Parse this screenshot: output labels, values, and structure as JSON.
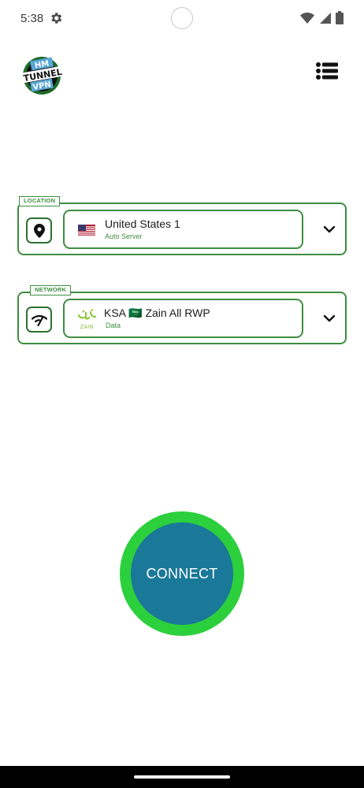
{
  "status_bar": {
    "time": "5:38",
    "icons": [
      "settings-gear-icon",
      "wifi-icon",
      "signal-icon",
      "battery-icon"
    ]
  },
  "header": {
    "logo_lines": [
      "HM",
      "TUNNEL",
      "VPN"
    ],
    "menu_icon": "list-menu-icon"
  },
  "location": {
    "label": "LOCATION",
    "icon": "location-pin-icon",
    "flag": "us-flag-icon",
    "title": "United States 1",
    "subtitle": "Auto Server"
  },
  "network": {
    "label": "NETWORK",
    "icon": "network-signal-icon",
    "provider_logo_text": "ZAIN",
    "title": "KSA 🇸🇦 Zain All RWP",
    "subtitle": "Data"
  },
  "connect": {
    "label": "CONNECT"
  },
  "colors": {
    "accent_green": "#3e8e41",
    "connect_ring": "#2ccf3c",
    "connect_fill": "#1a7898",
    "zain_green": "#8cc63f"
  }
}
